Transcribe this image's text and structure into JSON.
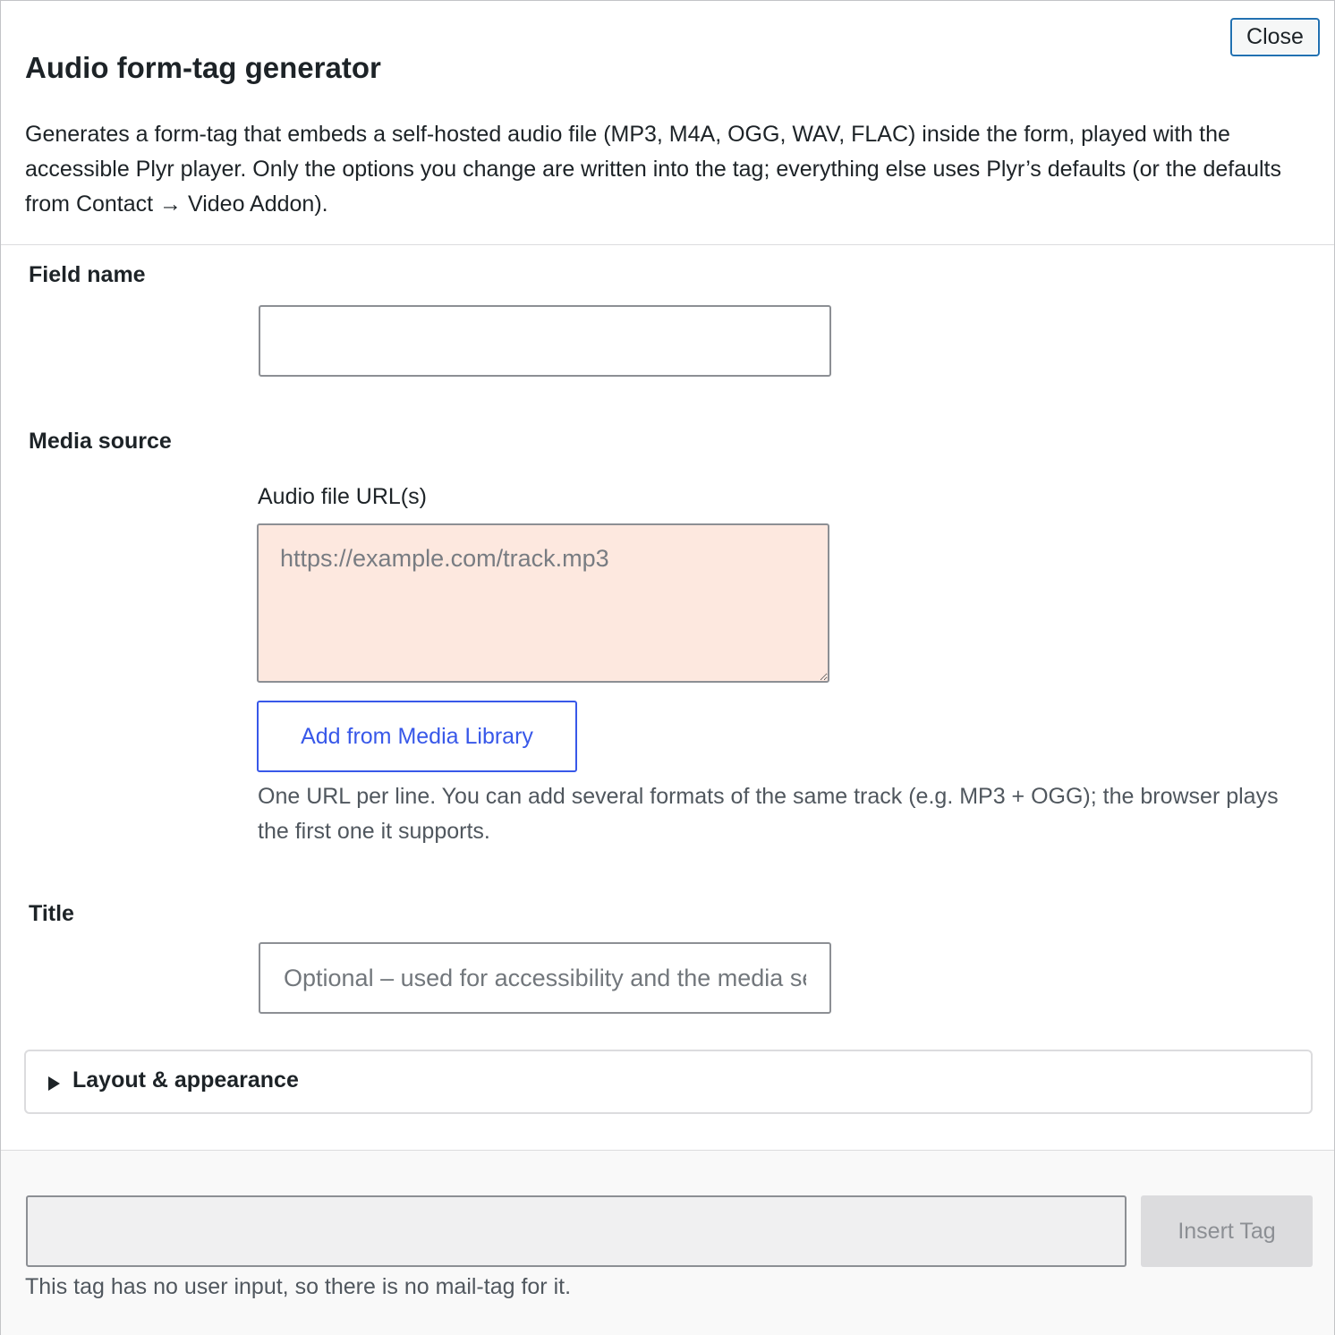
{
  "dialog": {
    "close_label": "Close",
    "title": "Audio form-tag generator",
    "description": "Generates a form-tag that embeds a self-hosted audio file (MP3, M4A, OGG, WAV, FLAC) inside the form, played with the accessible Plyr player. Only the options you change are written into the tag; everything else uses Plyr’s defaults (or the defaults from Contact → Video Addon)."
  },
  "field_name": {
    "label": "Field name",
    "value": "",
    "placeholder": ""
  },
  "media_source": {
    "label": "Media source",
    "url_label": "Audio file URL(s)",
    "url_placeholder": "https://example.com/track.mp3",
    "url_value": "",
    "media_button_label": "Add from Media Library",
    "help_text": "One URL per line. You can add several formats of the same track (e.g. MP3 + OGG); the browser plays the first one it supports."
  },
  "title_field": {
    "label": "Title",
    "placeholder": "Optional – used for accessibility and the media session",
    "value": ""
  },
  "layout_section": {
    "label": "Layout & appearance",
    "expanded": false,
    "icon": "disclosure-triangle-right-icon"
  },
  "footer": {
    "tag_value": "",
    "insert_label": "Insert Tag",
    "insert_disabled": true,
    "note": "This tag has no user input, so there is no mail-tag for it."
  },
  "colors": {
    "accent_border": "#2271b1",
    "media_button": "#3858e9",
    "invalid_field_bg": "#fde8df",
    "disabled_button_bg": "#dcdcde"
  }
}
